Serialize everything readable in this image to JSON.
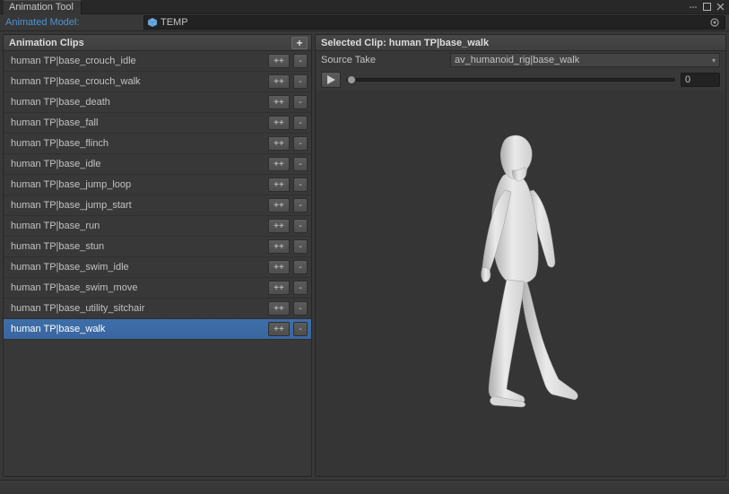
{
  "titlebar": {
    "title": "Animation Tool"
  },
  "model": {
    "label": "Animated Model:",
    "object_name": "TEMP"
  },
  "left": {
    "header": "Animation Clips",
    "add_label": "+",
    "dup_label": "++",
    "del_label": "-",
    "selected_index": 13,
    "clips": [
      "human TP|base_crouch_idle",
      "human TP|base_crouch_walk",
      "human TP|base_death",
      "human TP|base_fall",
      "human TP|base_flinch",
      "human TP|base_idle",
      "human TP|base_jump_loop",
      "human TP|base_jump_start",
      "human TP|base_run",
      "human TP|base_stun",
      "human TP|base_swim_idle",
      "human TP|base_swim_move",
      "human TP|base_utility_sitchair",
      "human TP|base_walk"
    ]
  },
  "right": {
    "header": "Selected Clip: human TP|base_walk",
    "source_label": "Source Take",
    "source_value": "av_humanoid_rig|base_walk",
    "frame_value": "0"
  }
}
